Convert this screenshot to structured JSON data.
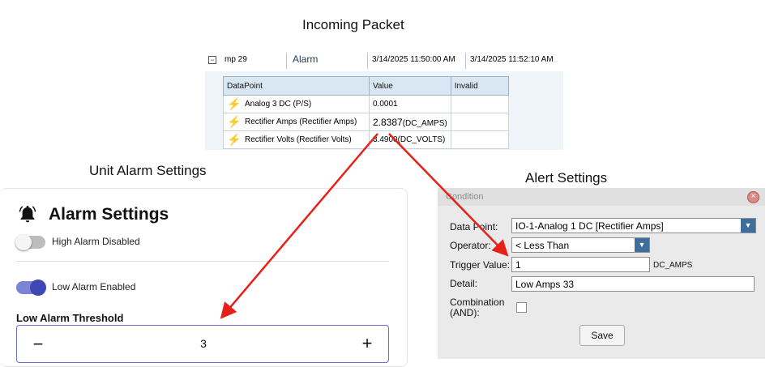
{
  "captions": {
    "incoming": "Incoming Packet",
    "unit": "Unit Alarm Settings",
    "alert": "Alert Settings"
  },
  "packet": {
    "header": {
      "expand_icon": "minus-box-icon",
      "mp": "mp 29",
      "type": "Alarm",
      "time1": "3/14/2025 11:50:00 AM",
      "time2": "3/14/2025 11:52:10 AM"
    },
    "columns": [
      "DataPoint",
      "Value",
      "Invalid"
    ],
    "rows": [
      {
        "icon": "lightning-bolt-icon",
        "datapoint": "Analog 3 DC (P/S)",
        "value": "0.0001",
        "unit": "",
        "invalid": ""
      },
      {
        "icon": "lightning-bolt-icon",
        "datapoint": "Rectifier Amps (Rectifier Amps)",
        "value": "2.8387",
        "unit": "(DC_AMPS)",
        "invalid": ""
      },
      {
        "icon": "lightning-bolt-icon",
        "datapoint": "Rectifier Volts (Rectifier Volts)",
        "value": "3.4900",
        "unit": "(DC_VOLTS)",
        "invalid": ""
      }
    ]
  },
  "unit_alarm": {
    "icon": "bell-icon",
    "title": "Alarm Settings",
    "high_label": "High Alarm Disabled",
    "high_enabled": false,
    "low_label": "Low Alarm Enabled",
    "low_enabled": true,
    "threshold_label": "Low Alarm Threshold",
    "threshold_value": "3",
    "minus": "−",
    "plus": "+"
  },
  "alert": {
    "title": "Condition",
    "close_icon": "close-icon",
    "datapoint_label": "Data Point:",
    "datapoint_value": "IO-1-Analog 1 DC [Rectifier Amps]",
    "operator_label": "Operator:",
    "operator_value": "< Less Than",
    "trigger_label": "Trigger Value:",
    "trigger_value": "1",
    "trigger_unit": "DC_AMPS",
    "detail_label": "Detail:",
    "detail_value": "Low Amps 33",
    "combo_label_1": "Combination",
    "combo_label_2": "(AND):",
    "combo_checked": false,
    "save_label": "Save"
  },
  "colors": {
    "arrow": "#e8201a",
    "toggle_on": "#3f47b5",
    "dropdown": "#3d6e9c"
  }
}
